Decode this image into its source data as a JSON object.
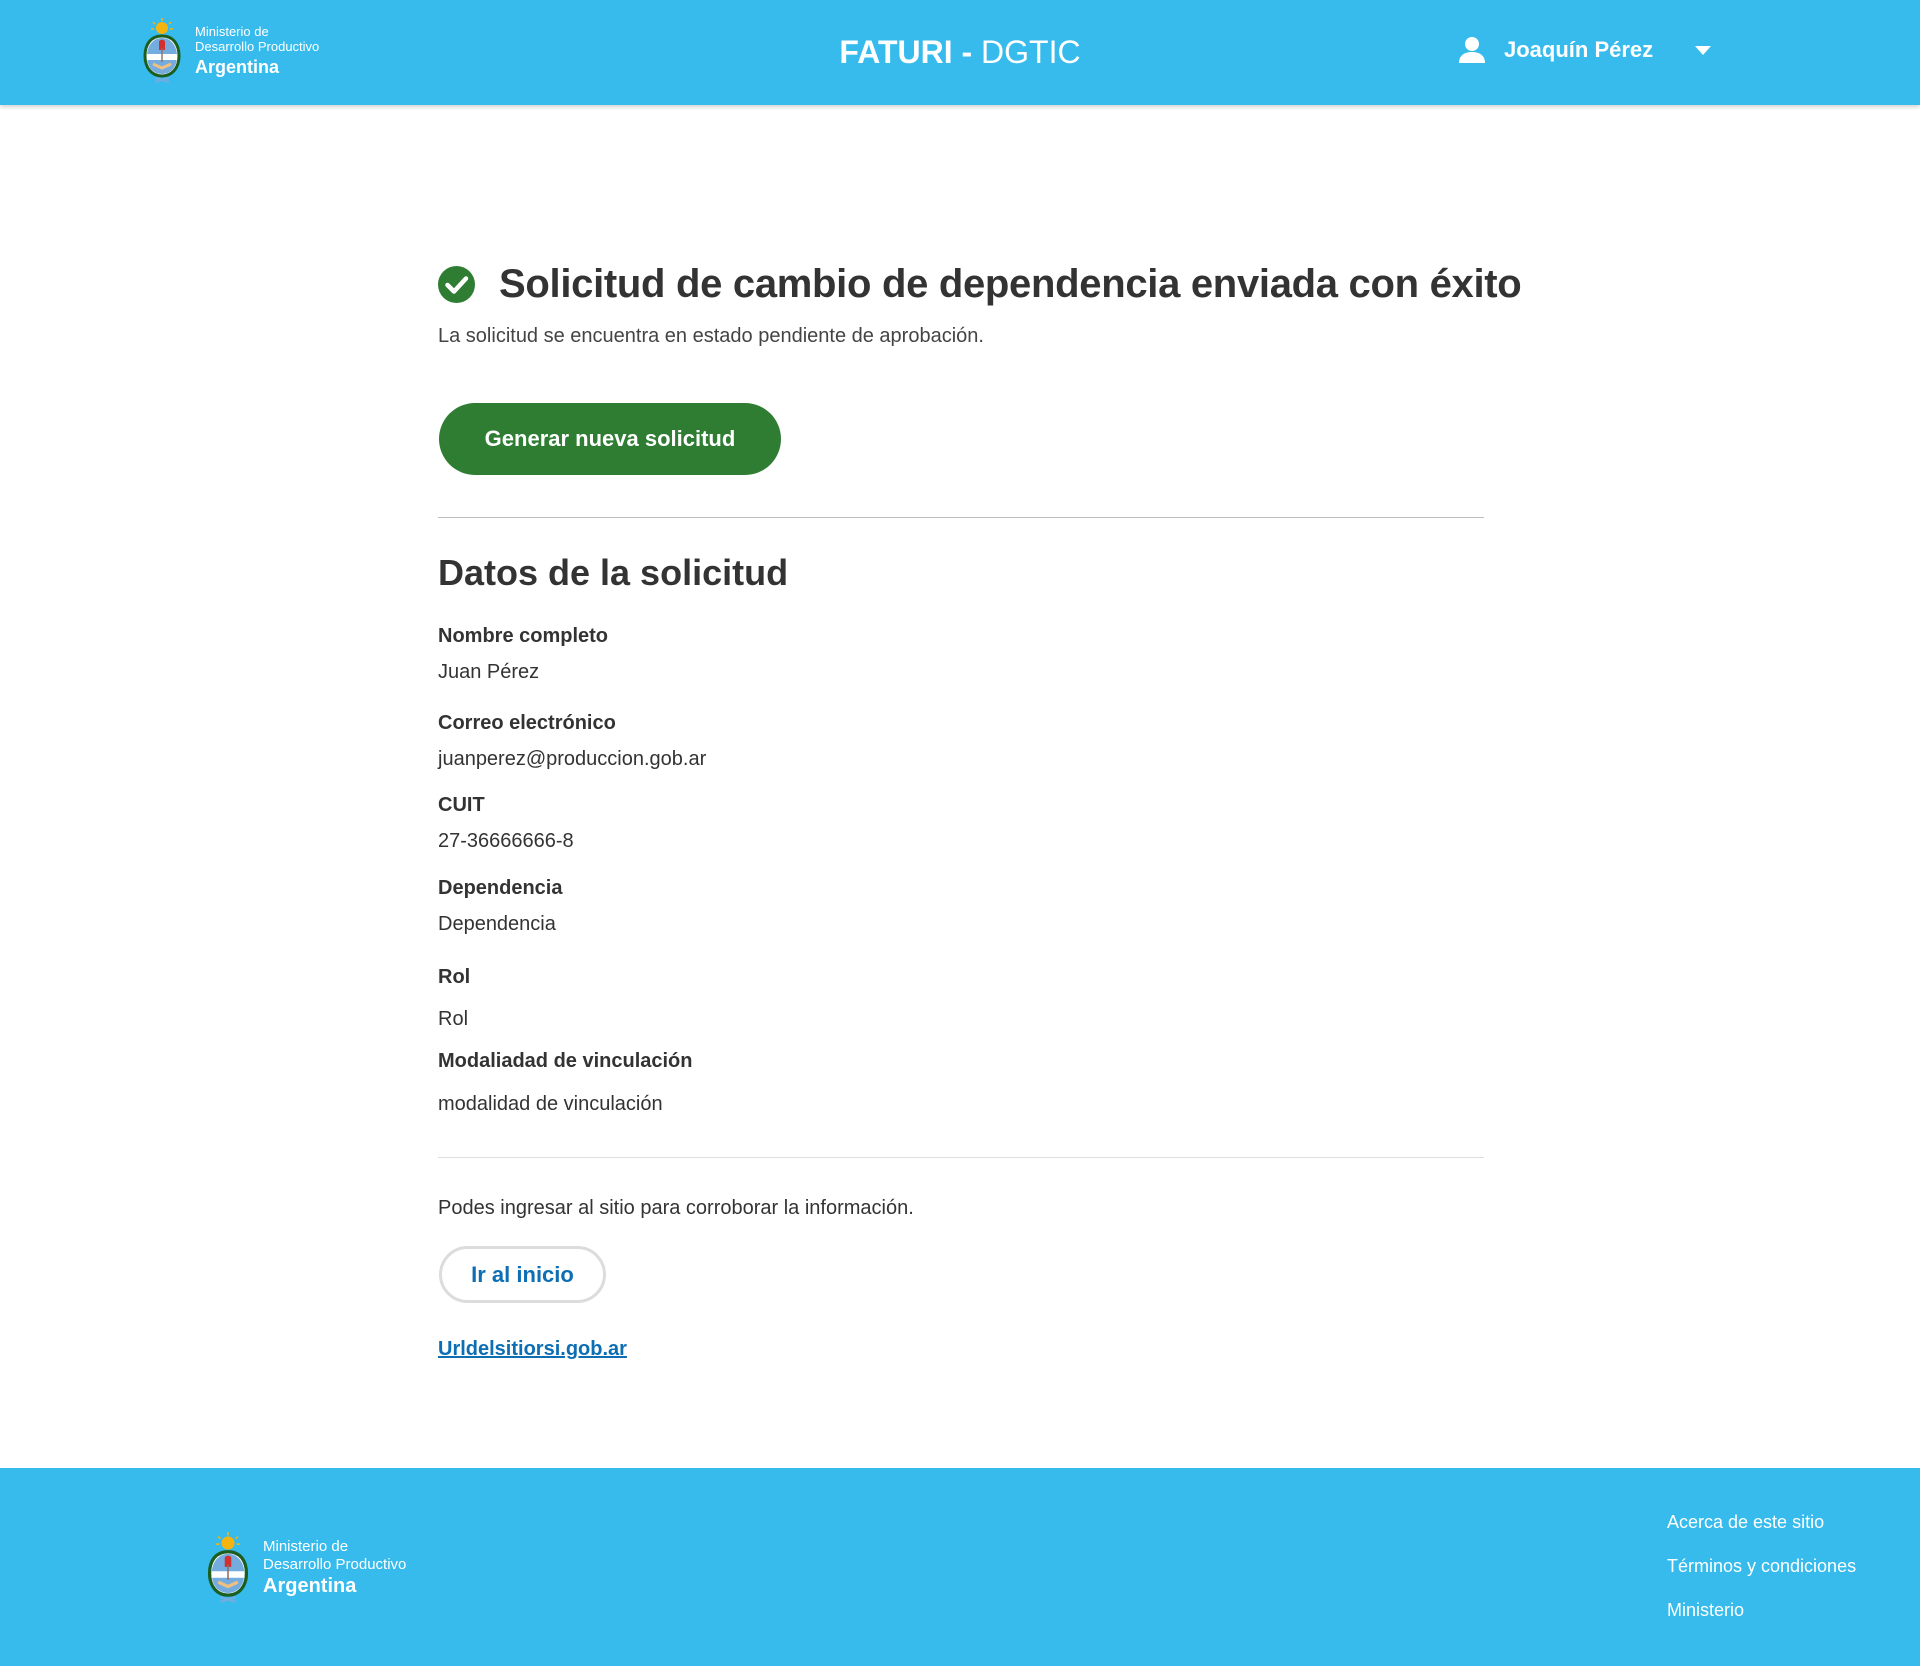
{
  "header": {
    "ministry_line1": "Ministerio de",
    "ministry_line2": "Desarrollo Productivo",
    "country": "Argentina",
    "app_title_strong": "FATURI -",
    "app_title_light": "DGTIC",
    "user_name": "Joaquín Pérez"
  },
  "main": {
    "success_title": "Solicitud de cambio de dependencia enviada con éxito",
    "subtitle": "La solicitud se encuentra en estado pendiente de aprobación.",
    "new_request_button": "Generar nueva solicitud",
    "section_title": "Datos de la solicitud",
    "fields": [
      {
        "label": "Nombre completo",
        "value": "Juan Pérez"
      },
      {
        "label": "Correo electrónico",
        "value": "juanperez@produccion.gob.ar"
      },
      {
        "label": "CUIT",
        "value": "27-36666666-8"
      },
      {
        "label": "Dependencia",
        "value": "Dependencia"
      },
      {
        "label": "Rol",
        "value": "Rol"
      },
      {
        "label": "Modaliadad de vinculación",
        "value": "modalidad de vinculación"
      }
    ],
    "info_text": "Podes ingresar al sitio para corroborar la información.",
    "home_button": "Ir al inicio",
    "site_link": "Urldelsitiorsi.gob.ar"
  },
  "footer": {
    "ministry_line1": "Ministerio de",
    "ministry_line2": "Desarrollo Productivo",
    "country": "Argentina",
    "links": [
      "Acerca de este sitio",
      "Términos y condiciones",
      "Ministerio"
    ]
  },
  "colors": {
    "header_bg": "#37BBED",
    "primary_green": "#2E7D32",
    "link_blue": "#0D6EB3",
    "text": "#333333"
  },
  "icons": {
    "logo": "argentina-coat-of-arms-icon",
    "user": "user-icon",
    "caret": "caret-down-icon",
    "success": "check-circle-icon"
  }
}
